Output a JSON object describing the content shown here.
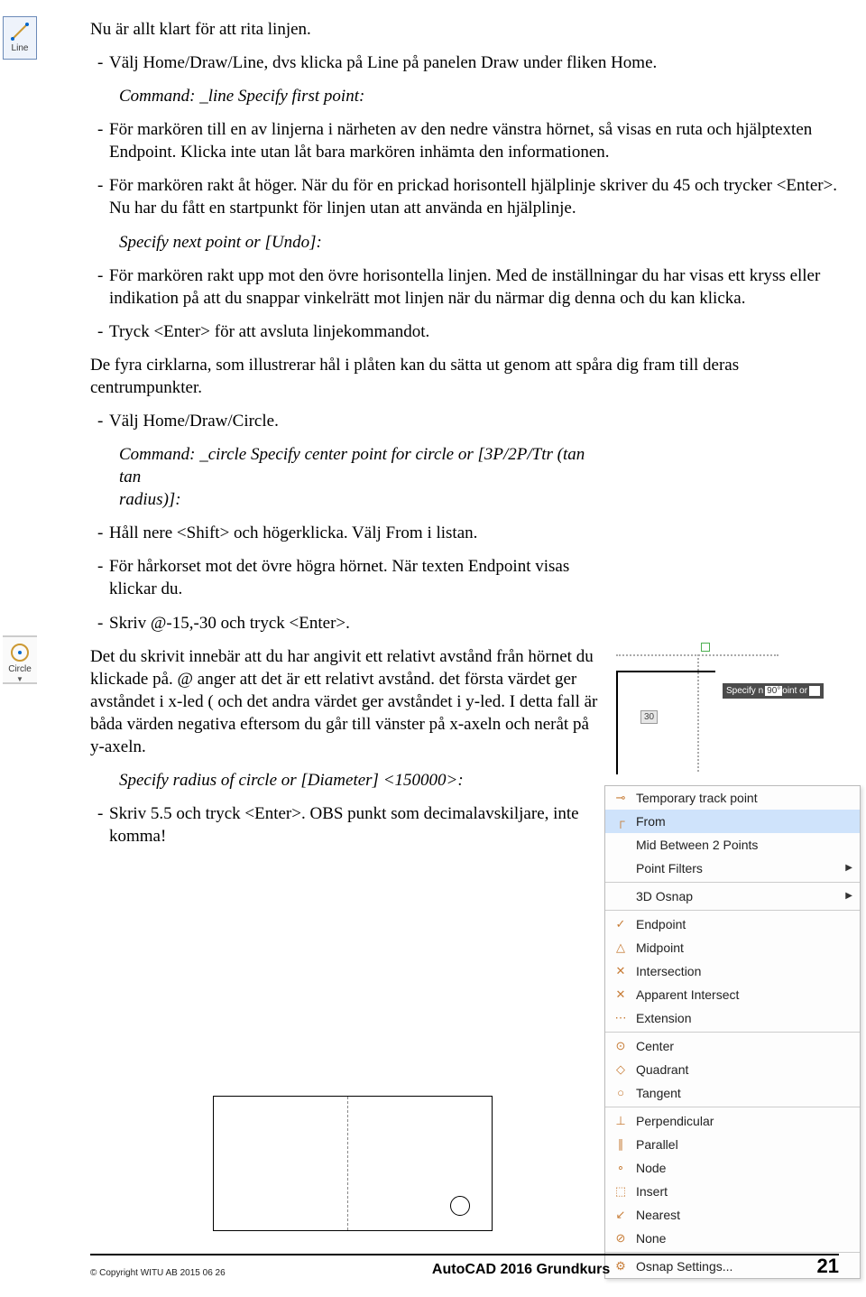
{
  "icons": {
    "line_label": "Line",
    "circle_label": "Circle"
  },
  "body": {
    "p1": "Nu är allt klart för att rita linjen.",
    "p2": "Välj Home/Draw/Line, dvs klicka på Line på panelen Draw under fliken Home.",
    "p3": "Command: _line Specify first point:",
    "p4": "För markören till en av linjerna i närheten av den nedre vänstra hörnet, så visas en ruta och hjälptexten Endpoint. Klicka inte utan låt bara markören inhämta den informationen.",
    "p5": "För markören rakt åt höger. När du för en prickad horisontell hjälplinje skriver du 45 och trycker <Enter>. Nu har du fått en startpunkt för linjen utan att använda en hjälplinje.",
    "p6": "Specify next point or [Undo]:",
    "p7": "För markören rakt upp mot den övre horisontella linjen. Med de inställningar du har visas ett kryss eller indikation på att du snappar vinkelrätt mot linjen när du närmar dig denna och du kan klicka.",
    "p8": "Tryck <Enter> för att avsluta linjekommandot.",
    "p9": "De fyra cirklarna, som illustrerar hål i plåten kan du sätta ut genom att spåra dig fram till deras centrumpunkter.",
    "p10": "Välj Home/Draw/Circle.",
    "p11a": "Command: _circle Specify center point for circle or [3P/2P/Ttr (tan tan",
    "p11b": "radius)]:",
    "p12": "Håll nere <Shift> och högerklicka. Välj From i listan.",
    "p13": "För hårkorset mot det övre högra hörnet. När texten Endpoint visas klickar du.",
    "p14": "Skriv @-15,-30 och tryck <Enter>.",
    "p15": "Det du skrivit innebär att du har angivit ett relativt avstånd från hörnet du klickade på. @ anger att det är ett relativt avstånd. det första värdet ger avståndet i x-led ( och det andra värdet ger avståndet i y-led. I detta fall är båda värden negativa eftersom du går till vänster på x-axeln och neråt på y-axeln.",
    "p16": "Specify radius of circle or [Diameter] <150000>:",
    "p17": "Skriv 5.5 och tryck <Enter>. OBS punkt som decimalavskiljare, inte komma!"
  },
  "fig1": {
    "dim": "30",
    "tooltip_pre": "Specify n",
    "tooltip_angle": "90°",
    "tooltip_post": "oint or"
  },
  "menu": {
    "items": [
      {
        "label": "Temporary track point",
        "icon": "⊸"
      },
      {
        "label": "From",
        "icon": "┌"
      },
      {
        "label": "Mid Between 2 Points",
        "icon": ""
      },
      {
        "label": "Point Filters",
        "icon": "",
        "submenu": true
      }
    ],
    "items2": [
      {
        "label": "3D Osnap",
        "icon": "",
        "submenu": true
      }
    ],
    "items3": [
      {
        "label": "Endpoint",
        "icon": "✓"
      },
      {
        "label": "Midpoint",
        "icon": "△"
      },
      {
        "label": "Intersection",
        "icon": "✕"
      },
      {
        "label": "Apparent Intersect",
        "icon": "✕"
      },
      {
        "label": "Extension",
        "icon": "⋯"
      }
    ],
    "items4": [
      {
        "label": "Center",
        "icon": "⊙"
      },
      {
        "label": "Quadrant",
        "icon": "◇"
      },
      {
        "label": "Tangent",
        "icon": "○"
      }
    ],
    "items5": [
      {
        "label": "Perpendicular",
        "icon": "⊥"
      },
      {
        "label": "Parallel",
        "icon": "∥"
      },
      {
        "label": "Node",
        "icon": "∘"
      },
      {
        "label": "Insert",
        "icon": "⬚"
      },
      {
        "label": "Nearest",
        "icon": "↙"
      },
      {
        "label": "None",
        "icon": "⊘"
      }
    ],
    "items6": [
      {
        "label": "Osnap Settings...",
        "icon": "⚙"
      }
    ]
  },
  "footer": {
    "copyright": "© Copyright WITU AB 2015 06 26",
    "title": "AutoCAD 2016 Grundkurs",
    "page": "21"
  }
}
